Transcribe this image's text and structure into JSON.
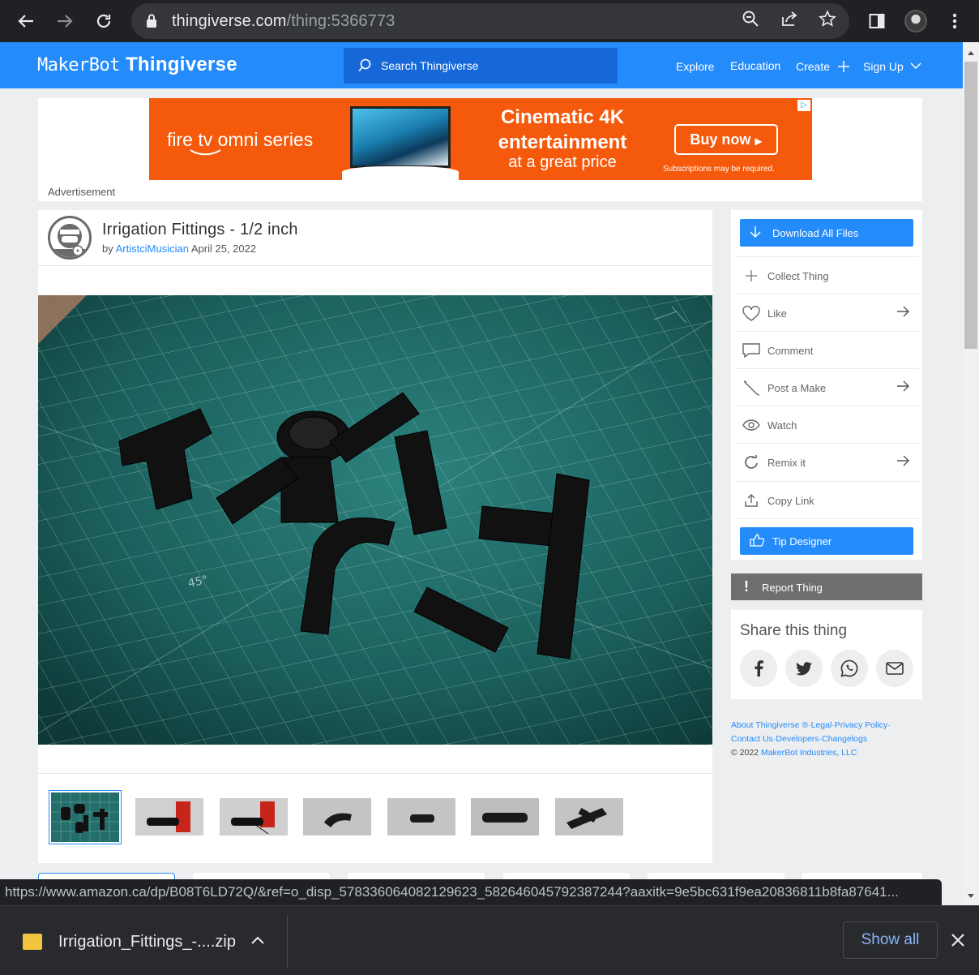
{
  "browser": {
    "url_domain": "thingiverse.com",
    "url_path": "/thing:5366773",
    "status_url": "https://www.amazon.ca/dp/B08T6LD72Q/&ref=o_disp_578336064082129623_582646045792387244?aaxitk=9e5bc631f9ea20836811b8fa87641..."
  },
  "header": {
    "logo_maker": "MakerBot",
    "logo_tv": "Thingiverse",
    "search_placeholder": "Search Thingiverse",
    "nav": {
      "explore": "Explore",
      "education": "Education",
      "create": "Create",
      "signup": "Sign Up"
    }
  },
  "ad": {
    "brand": "fire tv omni series",
    "headline_1": "Cinematic 4K",
    "headline_2": "entertainment",
    "subline": "at a great price",
    "cta": "Buy now",
    "fine_print": "Subscriptions may be required.",
    "label": "Advertisement"
  },
  "thing": {
    "title": "Irrigation Fittings - 1/2 inch",
    "by": "by",
    "author": "ArtistciMusician",
    "date": "April 25, 2022"
  },
  "actions": {
    "download": "Download All Files",
    "collect": "Collect Thing",
    "like": "Like",
    "comment": "Comment",
    "post_make": "Post a Make",
    "watch": "Watch",
    "remix": "Remix it",
    "copy_link": "Copy Link",
    "tip": "Tip Designer",
    "report": "Report Thing"
  },
  "share": {
    "title": "Share this thing"
  },
  "footer": {
    "line1": "About Thingiverse ®·Legal·Privacy Policy·",
    "line2": "Contact Us·Developers·Changelogs",
    "copyright": "©  2022",
    "company": "MakerBot Industries, LLC"
  },
  "download_bar": {
    "file_name": "Irrigation_Fittings_-....zip",
    "show_all": "Show all"
  },
  "colors": {
    "brand_blue": "#248bfb",
    "chrome_dark": "#202124",
    "ad_orange": "#f5590b"
  }
}
